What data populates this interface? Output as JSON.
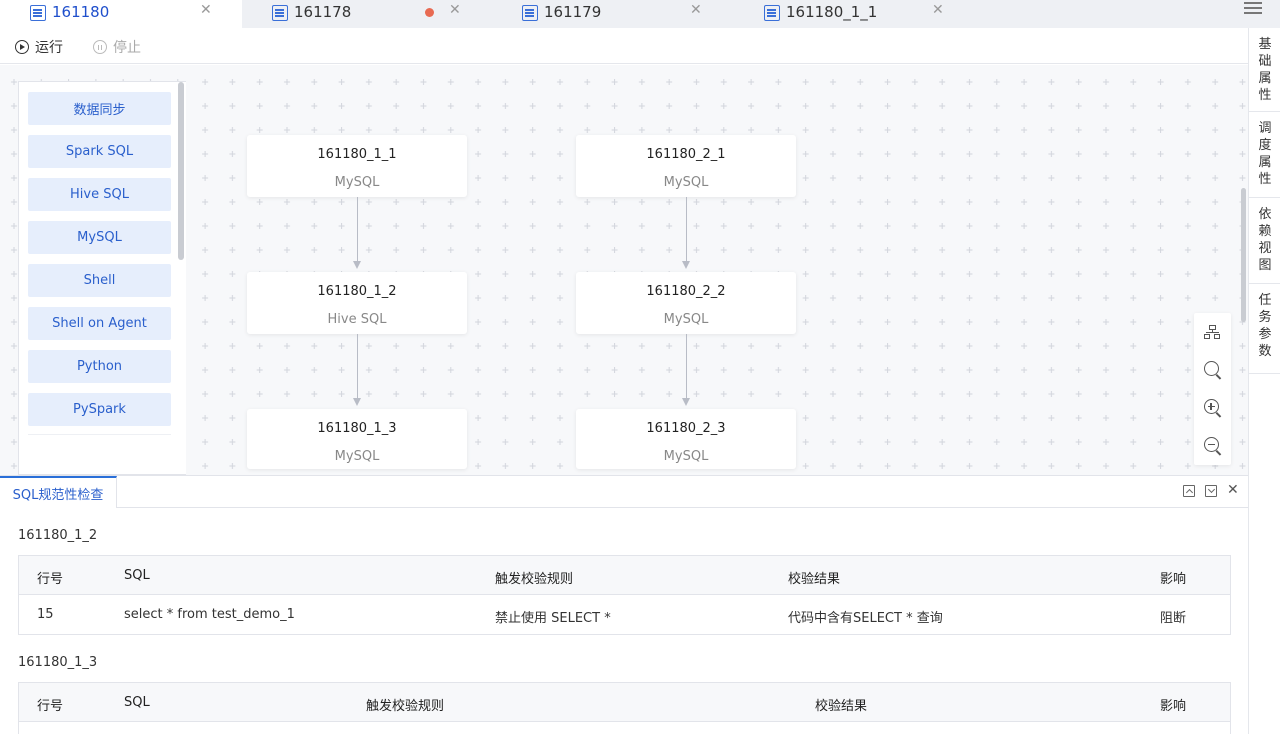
{
  "tabs": [
    {
      "label": "161180",
      "active": true,
      "modified": false
    },
    {
      "label": "161178",
      "active": false,
      "modified": true
    },
    {
      "label": "161179",
      "active": false,
      "modified": false
    },
    {
      "label": "161180_1_1",
      "active": false,
      "modified": false
    }
  ],
  "toolbar": {
    "run_label": "运行",
    "stop_label": "停止"
  },
  "palette": [
    "数据同步",
    "Spark SQL",
    "Hive SQL",
    "MySQL",
    "Shell",
    "Shell on Agent",
    "Python",
    "PySpark"
  ],
  "nodes": [
    {
      "name": "161180_1_1",
      "type": "MySQL"
    },
    {
      "name": "161180_1_2",
      "type": "Hive SQL"
    },
    {
      "name": "161180_1_3",
      "type": "MySQL"
    },
    {
      "name": "161180_2_1",
      "type": "MySQL"
    },
    {
      "name": "161180_2_2",
      "type": "MySQL"
    },
    {
      "name": "161180_2_3",
      "type": "MySQL"
    }
  ],
  "right_panel": [
    "基础属性",
    "调度属性",
    "依赖视图",
    "任务参数"
  ],
  "bottom": {
    "tab_label": "SQL规范性检查",
    "sections": [
      {
        "title": "161180_1_2",
        "headers": [
          "行号",
          "SQL",
          "触发校验规则",
          "校验结果",
          "影响"
        ],
        "rows": [
          [
            "15",
            "select * from test_demo_1",
            "禁止使用 SELECT *",
            "代码中含有SELECT * 查询",
            "阻断"
          ]
        ]
      },
      {
        "title": "161180_1_3",
        "headers": [
          "行号",
          "SQL",
          "触发校验规则",
          "校验结果",
          "影响"
        ],
        "rows": []
      }
    ]
  },
  "colors": {
    "accent": "#2a6fd8",
    "palette_bg": "#e6eefc",
    "modified_dot": "#e86a52"
  }
}
